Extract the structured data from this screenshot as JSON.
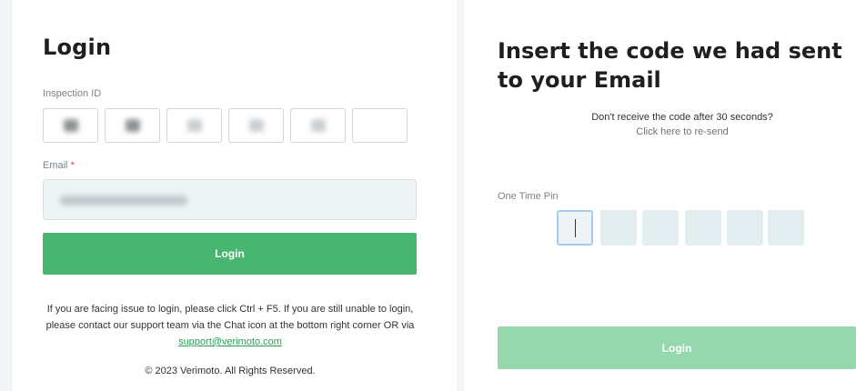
{
  "login_form": {
    "title": "Login",
    "inspection_id_label": "Inspection ID",
    "email_label": "Email",
    "email_required_mark": "*",
    "login_button": "Login",
    "help_text": "If you are facing issue to login, please click Ctrl + F5. If you are still unable to login, please contact our support team via the Chat icon at the bottom right corner OR via ",
    "support_email": "support@verimoto.com",
    "copyright": "© 2023 Verimoto. All Rights Reserved."
  },
  "otp_form": {
    "title": "Insert the code we had sent to your Email",
    "resend_question": "Don't receive the code after 30 seconds?",
    "resend_link": "Click here to re-send",
    "pin_label": "One Time Pin",
    "pin_digits": 6,
    "login_button": "Login"
  },
  "colors": {
    "primary_button": "#48b671",
    "disabled_button": "#95d8ad",
    "link": "#2c9b55",
    "required": "#e23a3a"
  }
}
